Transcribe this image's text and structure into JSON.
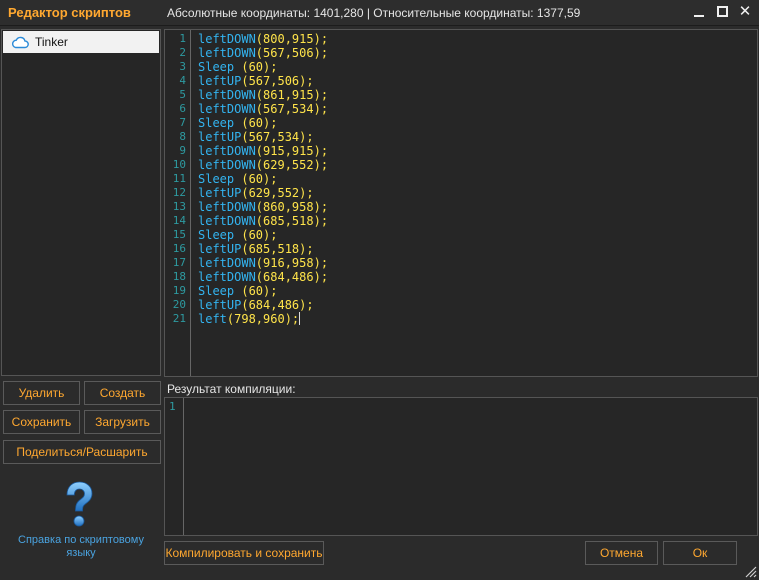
{
  "window": {
    "title": "Редактор скриптов",
    "coords_text": "Абсолютные координаты: 1401,280 | Относительные координаты: 1377,59",
    "minimize_icon": "minimize-icon",
    "maximize_icon": "maximize-icon",
    "close_icon": "close-icon"
  },
  "scripts": [
    {
      "name": "Tinker",
      "icon": "cloud-icon",
      "selected": true
    }
  ],
  "buttons": {
    "delete": "Удалить",
    "create": "Создать",
    "save": "Сохранить",
    "load": "Загрузить",
    "share": "Поделиться/Расшарить",
    "compile": "Компилировать и сохранить",
    "cancel": "Отмена",
    "ok": "Ок"
  },
  "help": {
    "icon": "question-mark-icon",
    "text": "Справка по скриптовому языку"
  },
  "editor": {
    "lines": [
      {
        "fn": "leftDOWN",
        "args": "(800,915);"
      },
      {
        "fn": "leftDOWN",
        "args": "(567,506);"
      },
      {
        "fn": "Sleep",
        "args": " (60);"
      },
      {
        "fn": "leftUP",
        "args": "(567,506);"
      },
      {
        "fn": "leftDOWN",
        "args": "(861,915);"
      },
      {
        "fn": "leftDOWN",
        "args": "(567,534);"
      },
      {
        "fn": "Sleep",
        "args": " (60);"
      },
      {
        "fn": "leftUP",
        "args": "(567,534);"
      },
      {
        "fn": "leftDOWN",
        "args": "(915,915);"
      },
      {
        "fn": "leftDOWN",
        "args": "(629,552);"
      },
      {
        "fn": "Sleep",
        "args": " (60);"
      },
      {
        "fn": "leftUP",
        "args": "(629,552);"
      },
      {
        "fn": "leftDOWN",
        "args": "(860,958);"
      },
      {
        "fn": "leftDOWN",
        "args": "(685,518);"
      },
      {
        "fn": "Sleep",
        "args": " (60);"
      },
      {
        "fn": "leftUP",
        "args": "(685,518);"
      },
      {
        "fn": "leftDOWN",
        "args": "(916,958);"
      },
      {
        "fn": "leftDOWN",
        "args": "(684,486);"
      },
      {
        "fn": "Sleep",
        "args": " (60);"
      },
      {
        "fn": "leftUP",
        "args": "(684,486);"
      },
      {
        "fn": "left",
        "args": "(798,960);"
      }
    ]
  },
  "compilation": {
    "label": "Результат компиляции:",
    "lines": [
      "1"
    ]
  },
  "colors": {
    "accent": "#ffa830",
    "keyword": "#33b4f0",
    "code_text": "#ffe44a",
    "line_number": "#2e9aa0",
    "link": "#4aa3e0"
  }
}
